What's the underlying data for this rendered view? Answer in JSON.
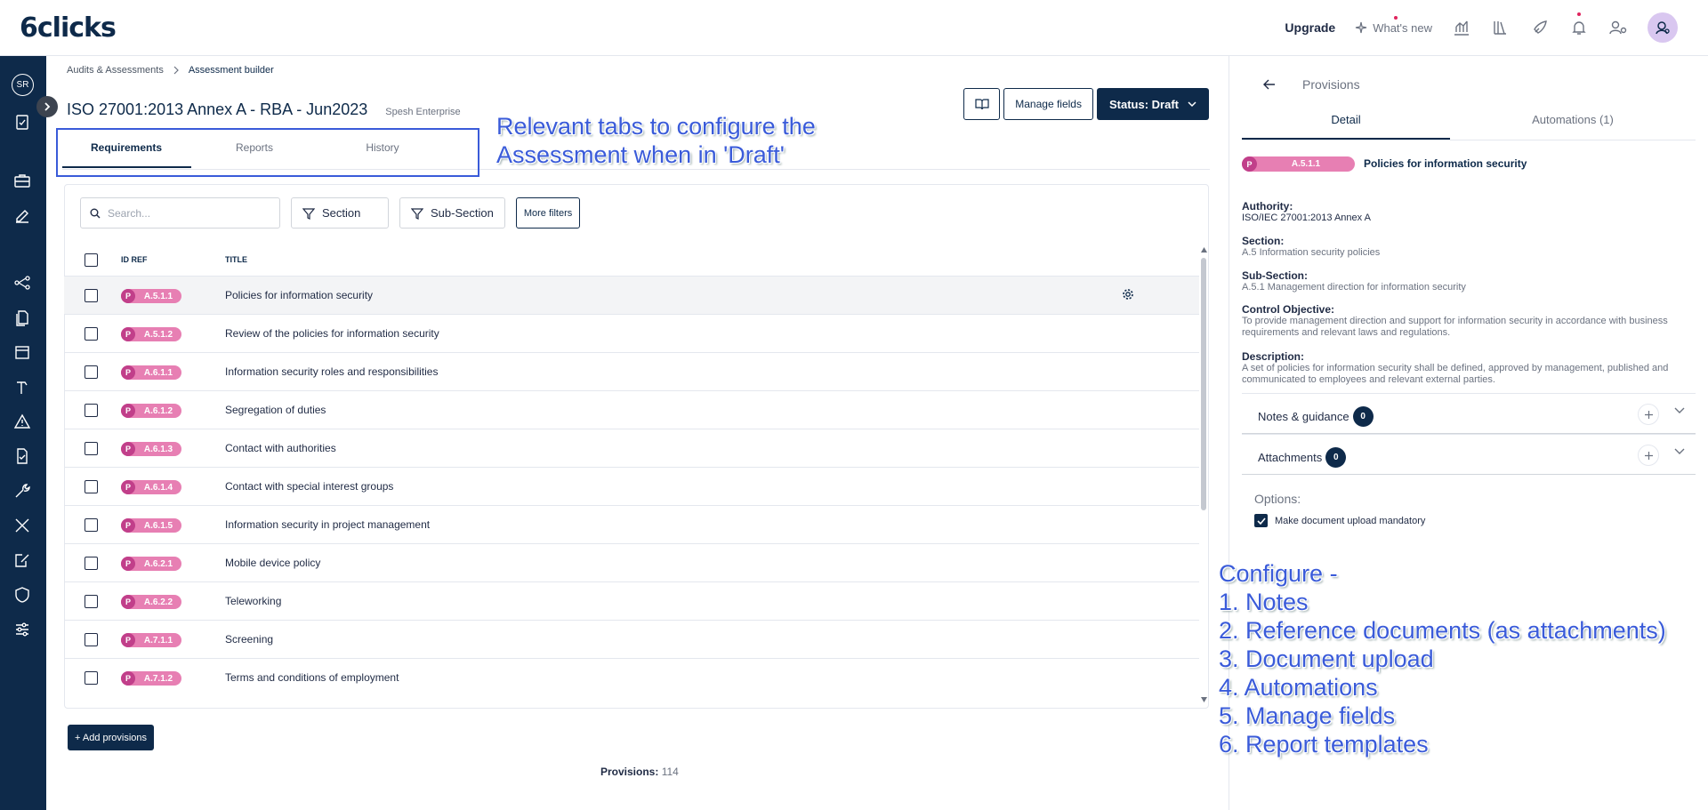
{
  "app": {
    "logo": "6clicks"
  },
  "topbar": {
    "upgrade": "Upgrade",
    "whats_new": "What's new",
    "icons": [
      "analytics-icon",
      "library-icon",
      "rocket-icon",
      "bell-icon",
      "users-settings-icon",
      "user-avatar-icon"
    ]
  },
  "sidebar": {
    "user_initials": "SR",
    "icons": [
      "clipboard-check-icon",
      "briefcase-icon",
      "edit-icon",
      "network-icon",
      "documents-icon",
      "calendar-icon",
      "hammer-icon",
      "warning-icon",
      "document-check-icon",
      "wrench-icon",
      "tools-icon",
      "edit-doc-icon",
      "shield-icon",
      "sliders-icon"
    ]
  },
  "breadcrumb": {
    "parent": "Audits & Assessments",
    "current": "Assessment builder"
  },
  "header": {
    "title": "ISO 27001:2013 Annex A - RBA - Jun2023",
    "org": "Spesh Enterprise",
    "manage_fields": "Manage fields",
    "status": "Status: Draft"
  },
  "tabs": [
    {
      "label": "Requirements",
      "active": true
    },
    {
      "label": "Reports",
      "active": false
    },
    {
      "label": "History",
      "active": false
    }
  ],
  "annotations": {
    "tabs_note": [
      "Relevant tabs to configure the",
      "Assessment when in 'Draft'"
    ],
    "configure": [
      "Configure -",
      "1. Notes",
      "2. Reference documents (as attachments)",
      "3. Document upload",
      "4. Automations",
      "5. Manage fields",
      "6. Report templates"
    ]
  },
  "filters": {
    "search_placeholder": "Search...",
    "section": "Section",
    "sub_section": "Sub-Section",
    "more_filters": "More filters"
  },
  "table": {
    "columns": [
      "ID REF",
      "TITLE"
    ],
    "rows": [
      {
        "type": "P",
        "ref": "A.5.1.1",
        "title": "Policies for information security",
        "selected": true
      },
      {
        "type": "P",
        "ref": "A.5.1.2",
        "title": "Review of the policies for information security"
      },
      {
        "type": "P",
        "ref": "A.6.1.1",
        "title": "Information security roles and responsibilities"
      },
      {
        "type": "P",
        "ref": "A.6.1.2",
        "title": "Segregation of duties"
      },
      {
        "type": "P",
        "ref": "A.6.1.3",
        "title": "Contact with authorities"
      },
      {
        "type": "P",
        "ref": "A.6.1.4",
        "title": "Contact with special interest groups"
      },
      {
        "type": "P",
        "ref": "A.6.1.5",
        "title": "Information security in project management"
      },
      {
        "type": "P",
        "ref": "A.6.2.1",
        "title": "Mobile device policy"
      },
      {
        "type": "P",
        "ref": "A.6.2.2",
        "title": "Teleworking"
      },
      {
        "type": "P",
        "ref": "A.7.1.1",
        "title": "Screening"
      },
      {
        "type": "P",
        "ref": "A.7.1.2",
        "title": "Terms and conditions of employment"
      }
    ]
  },
  "footer": {
    "add_provisions": "+ Add provisions",
    "provisions_label": "Provisions:",
    "provisions_count": "114"
  },
  "panel": {
    "title": "Provisions",
    "tabs": [
      "Detail",
      "Automations (1)"
    ],
    "type": "P",
    "ref": "A.5.1.1",
    "name": "Policies for information security",
    "fields": [
      {
        "label": "Authority:",
        "value": "ISO/IEC 27001:2013 Annex A"
      },
      {
        "label": "Section:",
        "value": "A.5 Information security policies"
      },
      {
        "label": "Sub-Section:",
        "value": "A.5.1 Management direction for information security"
      },
      {
        "label": "Control Objective:",
        "value": "To provide management direction and support for information security in accordance with business requirements and relevant laws and regulations."
      },
      {
        "label": "Description:",
        "value": "A set of policies for information security shall be defined, approved by management, published and communicated to employees and relevant external parties."
      }
    ],
    "notes_label": "Notes & guidance",
    "notes_count": "0",
    "attachments_label": "Attachments",
    "attachments_count": "0",
    "options_label": "Options:",
    "option_upload": "Make document upload mandatory"
  },
  "colors": {
    "navy": "#0e2a4a",
    "pill": "#e77fb3",
    "annotation": "#3a5bd9"
  }
}
